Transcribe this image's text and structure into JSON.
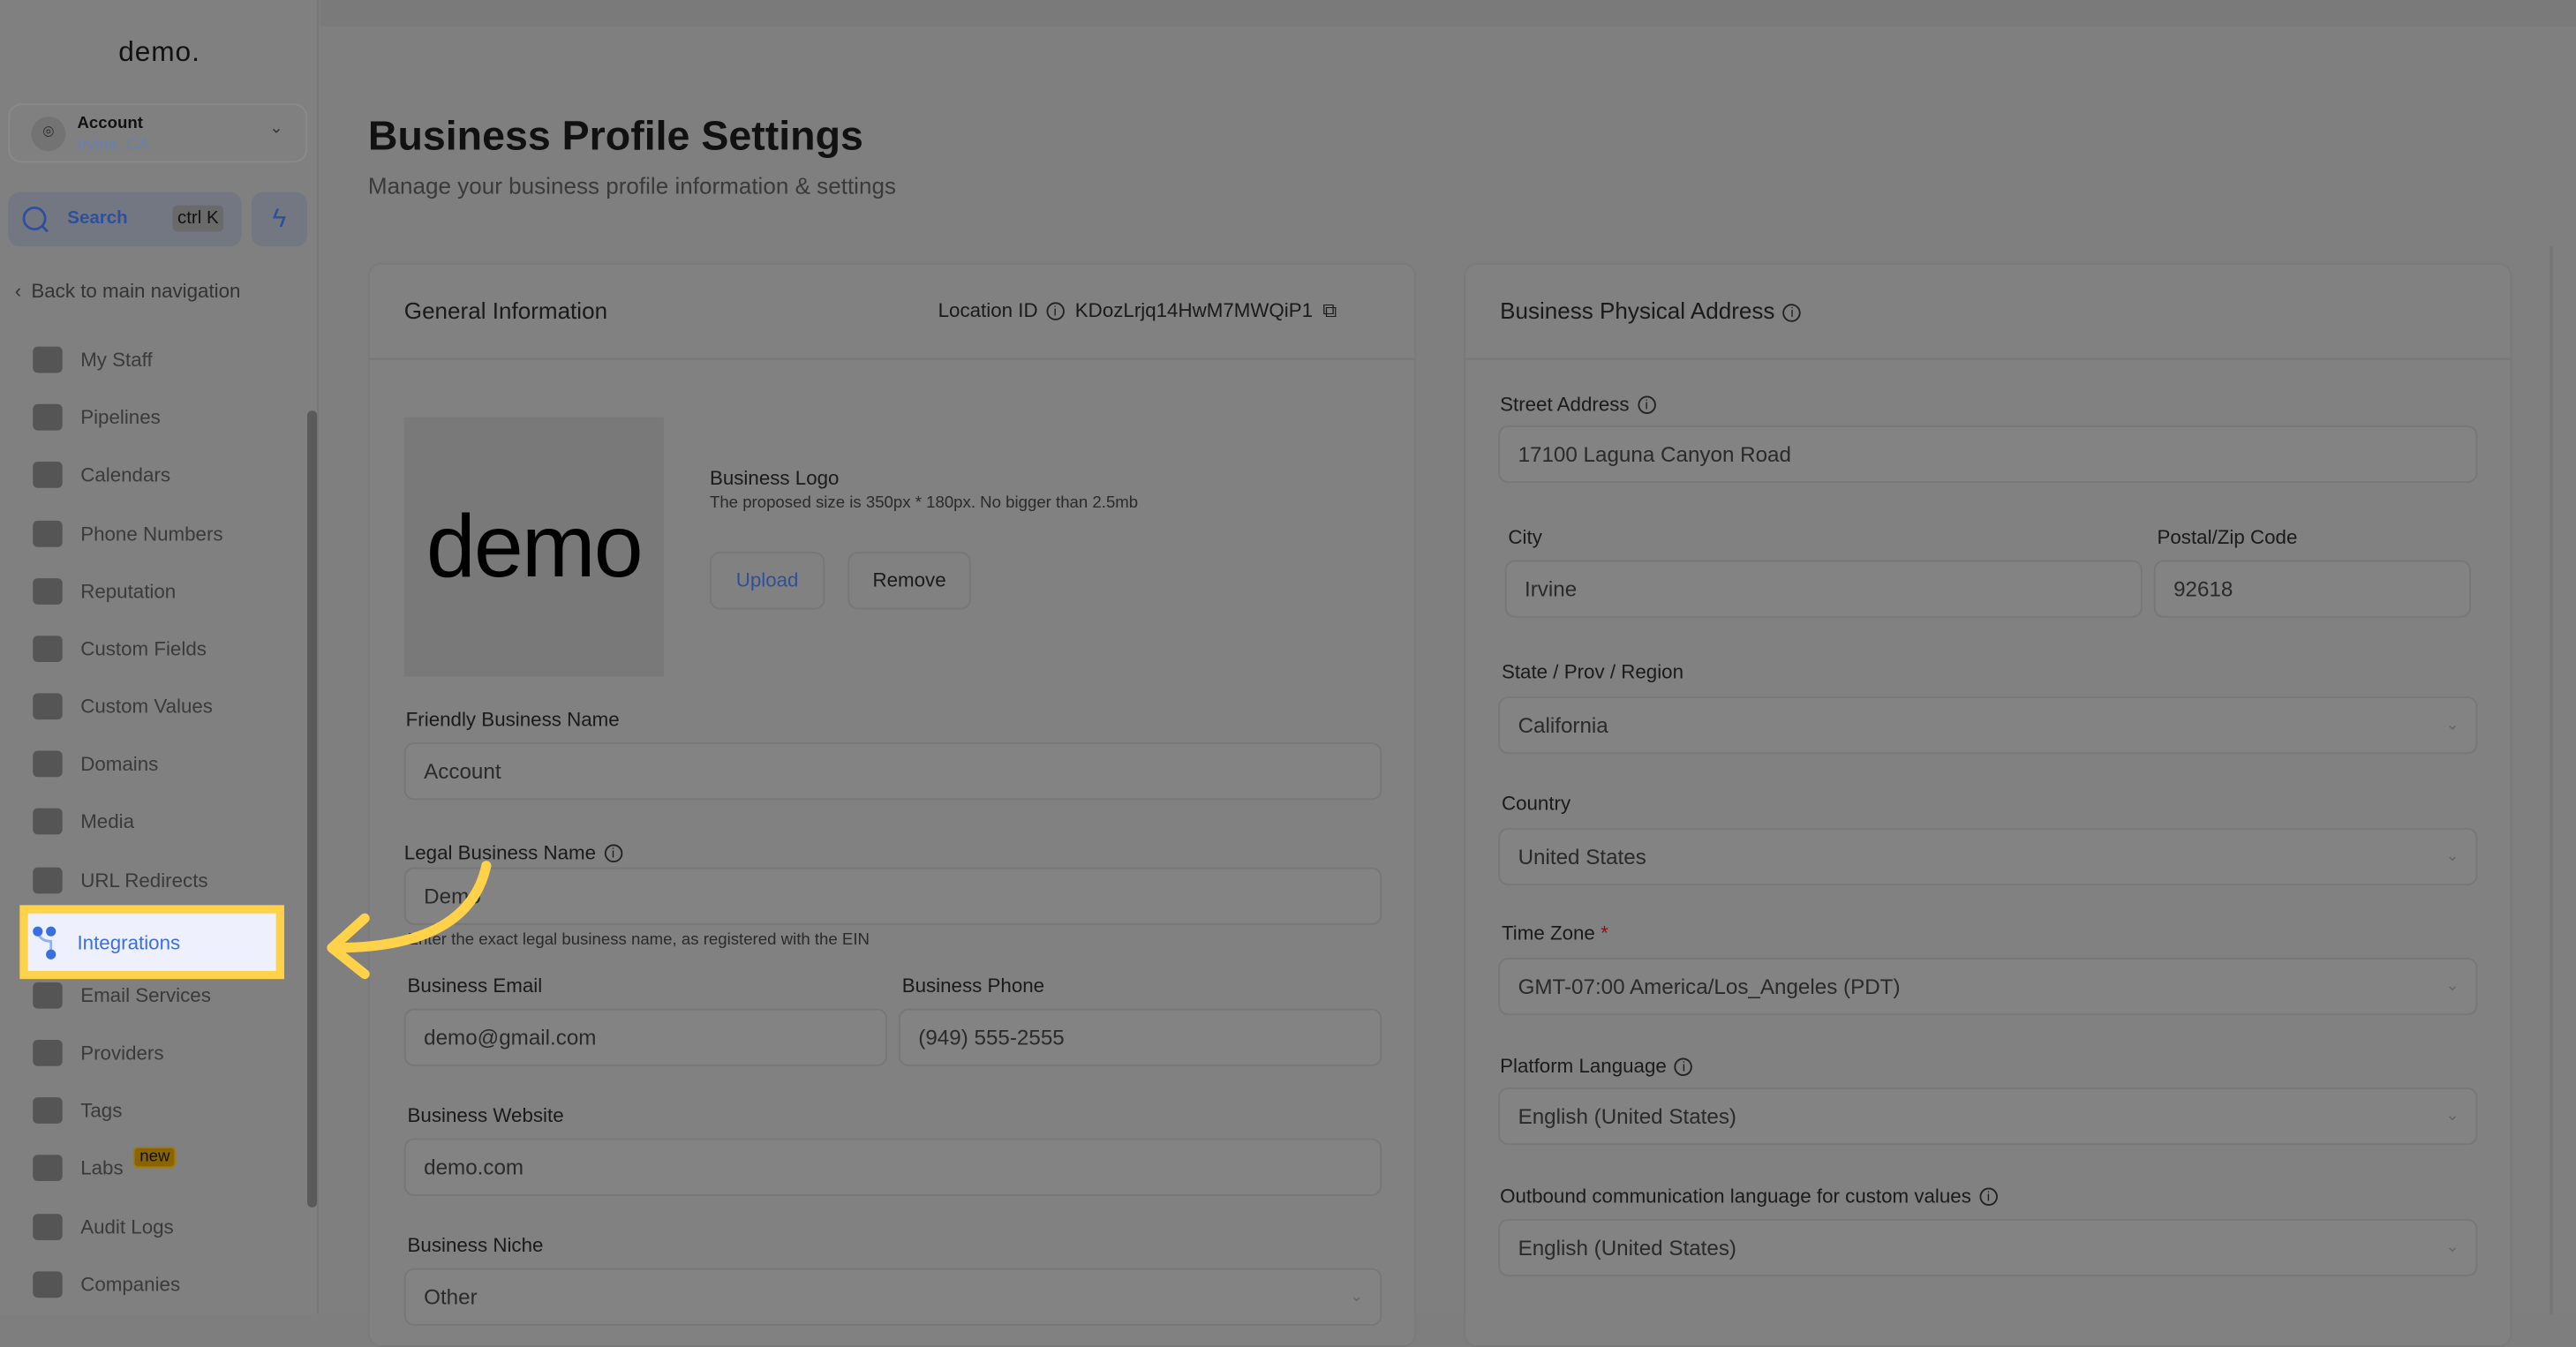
{
  "sidebar": {
    "logo": "demo.",
    "account": {
      "name": "Account",
      "location": "Irvine, CA"
    },
    "search": {
      "label": "Search",
      "shortcut": "ctrl K"
    },
    "back": "Back to main navigation",
    "items": [
      {
        "label": "My Staff"
      },
      {
        "label": "Pipelines"
      },
      {
        "label": "Calendars"
      },
      {
        "label": "Phone Numbers"
      },
      {
        "label": "Reputation"
      },
      {
        "label": "Custom Fields"
      },
      {
        "label": "Custom Values"
      },
      {
        "label": "Domains"
      },
      {
        "label": "Media"
      },
      {
        "label": "URL Redirects"
      },
      {
        "label": "Integrations",
        "active": true
      },
      {
        "label": "Email Services"
      },
      {
        "label": "Providers"
      },
      {
        "label": "Tags"
      },
      {
        "label": "Labs",
        "badge": "new"
      },
      {
        "label": "Audit Logs"
      },
      {
        "label": "Companies"
      }
    ]
  },
  "header": {
    "title": "Business Profile Settings",
    "subtitle": "Manage your business profile information & settings"
  },
  "general": {
    "title": "General Information",
    "location_id_label": "Location ID",
    "location_id": "KDozLrjq14HwM7MWQiP1",
    "logo_text": "demo",
    "logo_label": "Business Logo",
    "logo_note": "The proposed size is 350px * 180px. No bigger than 2.5mb",
    "upload": "Upload",
    "remove": "Remove",
    "friendly_label": "Friendly Business Name",
    "friendly_value": "Account",
    "legal_label": "Legal Business Name",
    "legal_value": "Demo",
    "legal_help": "Enter the exact legal business name, as registered with the EIN",
    "email_label": "Business Email",
    "email_value": "demo@gmail.com",
    "phone_label": "Business Phone",
    "phone_value": "(949) 555-2555",
    "website_label": "Business Website",
    "website_value": "demo.com",
    "niche_label": "Business Niche",
    "niche_value": "Other"
  },
  "address": {
    "title": "Business Physical Address",
    "street_label": "Street Address",
    "street_value": "17100 Laguna Canyon Road",
    "city_label": "City",
    "city_value": "Irvine",
    "zip_label": "Postal/Zip Code",
    "zip_value": "92618",
    "state_label": "State / Prov / Region",
    "state_value": "California",
    "country_label": "Country",
    "country_value": "United States",
    "tz_label": "Time Zone",
    "tz_required": "*",
    "tz_value": "GMT-07:00 America/Los_Angeles (PDT)",
    "lang_label": "Platform Language",
    "lang_value": "English (United States)",
    "outbound_label": "Outbound communication language for custom values",
    "outbound_value": "English (United States)"
  },
  "colors": {
    "accent": "#3b6fe0",
    "highlight": "#ffd24a",
    "overlay": "#7f7f7f"
  }
}
